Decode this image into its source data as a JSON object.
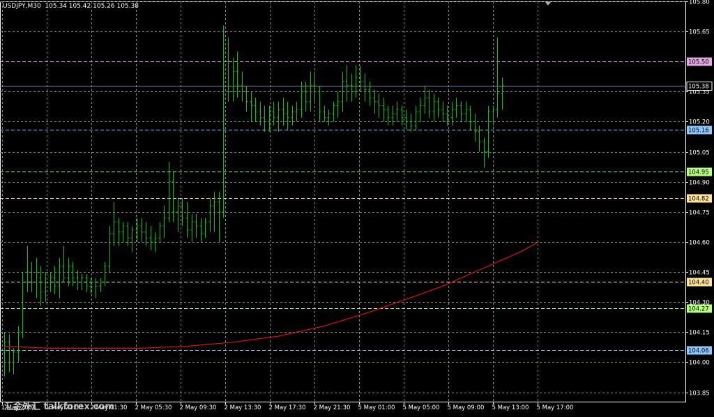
{
  "title": "USDJPY,M30  105.34 105.42 105.26 105.38",
  "watermark": "汇金外汇 talkforex.com",
  "colors": {
    "background": "#000000",
    "grid": "#8a8a8a",
    "bar": "#00c800",
    "ma_line": "#dd1111",
    "axis_text": "#ffffff",
    "frame": "#ffffff"
  },
  "chart_data": {
    "type": "ohlc",
    "symbol": "USDJPY",
    "timeframe": "M30",
    "header_ohlc": {
      "open": 105.34,
      "high": 105.42,
      "low": 105.26,
      "close": 105.38
    },
    "ylim": [
      103.8,
      105.8
    ],
    "y_ticks": [
      "105.80",
      "105.65",
      "105.35",
      "105.20",
      "105.05",
      "104.90",
      "104.75",
      "104.60",
      "104.45",
      "104.30",
      "104.15",
      "104.00",
      "103.85"
    ],
    "x_ticks": [
      "1 May 2008",
      "1 May 21:30",
      "2 May 01:30",
      "2 May 05:30",
      "2 May 09:30",
      "2 May 13:30",
      "2 May 17:30",
      "2 May 21:30",
      "5 May 01:00",
      "5 May 05:00",
      "5 May 09:00",
      "5 May 13:00",
      "5 May 17:00"
    ],
    "grid": true,
    "price_levels": [
      {
        "label": "105.50",
        "value": 105.5,
        "color": "#e0a8e0"
      },
      {
        "label": "105.38",
        "value": 105.38,
        "color": "#ffffff",
        "current": true
      },
      {
        "label": "105.16",
        "value": 105.16,
        "color": "#8cc8ff"
      },
      {
        "label": "104.95",
        "value": 104.95,
        "color": "#b8ff80"
      },
      {
        "label": "104.82",
        "value": 104.82,
        "color": "#ffe39a"
      },
      {
        "label": "104.40",
        "value": 104.4,
        "color": "#ffe39a"
      },
      {
        "label": "104.27",
        "value": 104.27,
        "color": "#b8ff80"
      },
      {
        "label": "104.06",
        "value": 104.06,
        "color": "#8cc8ff"
      }
    ],
    "bars": [
      [
        104.05,
        104.15,
        103.93,
        104.1
      ],
      [
        104.1,
        104.14,
        103.95,
        104.0
      ],
      [
        104.0,
        104.07,
        103.94,
        104.05
      ],
      [
        104.05,
        104.18,
        104.0,
        104.15
      ],
      [
        104.15,
        104.45,
        104.12,
        104.4
      ],
      [
        104.4,
        104.58,
        104.35,
        104.45
      ],
      [
        104.45,
        104.5,
        104.35,
        104.4
      ],
      [
        104.4,
        104.52,
        104.32,
        104.45
      ],
      [
        104.42,
        104.48,
        104.28,
        104.35
      ],
      [
        104.35,
        104.45,
        104.3,
        104.4
      ],
      [
        104.4,
        104.45,
        104.35,
        104.42
      ],
      [
        104.42,
        104.48,
        104.34,
        104.38
      ],
      [
        104.38,
        104.52,
        104.32,
        104.48
      ],
      [
        104.48,
        104.58,
        104.4,
        104.42
      ],
      [
        104.42,
        104.52,
        104.38,
        104.48
      ],
      [
        104.48,
        104.5,
        104.38,
        104.42
      ],
      [
        104.42,
        104.46,
        104.36,
        104.4
      ],
      [
        104.4,
        104.44,
        104.36,
        104.42
      ],
      [
        104.42,
        104.44,
        104.35,
        104.38
      ],
      [
        104.38,
        104.42,
        104.34,
        104.4
      ],
      [
        104.4,
        104.42,
        104.32,
        104.38
      ],
      [
        104.38,
        104.42,
        104.35,
        104.4
      ],
      [
        104.4,
        104.5,
        104.38,
        104.48
      ],
      [
        104.48,
        104.68,
        104.45,
        104.64
      ],
      [
        104.64,
        104.8,
        104.58,
        104.7
      ],
      [
        104.7,
        104.72,
        104.58,
        104.65
      ],
      [
        104.65,
        104.7,
        104.6,
        104.68
      ],
      [
        104.68,
        104.7,
        104.58,
        104.62
      ],
      [
        104.62,
        104.68,
        104.55,
        104.66
      ],
      [
        104.66,
        104.72,
        104.6,
        104.68
      ],
      [
        104.68,
        104.72,
        104.6,
        104.65
      ],
      [
        104.65,
        104.7,
        104.58,
        104.62
      ],
      [
        104.62,
        104.68,
        104.56,
        104.6
      ],
      [
        104.6,
        104.65,
        104.55,
        104.62
      ],
      [
        104.62,
        104.7,
        104.6,
        104.68
      ],
      [
        104.68,
        104.78,
        104.62,
        104.72
      ],
      [
        104.72,
        105.0,
        104.7,
        104.9
      ],
      [
        104.9,
        104.95,
        104.7,
        104.75
      ],
      [
        104.75,
        104.82,
        104.65,
        104.78
      ],
      [
        104.78,
        104.82,
        104.68,
        104.72
      ],
      [
        104.72,
        104.8,
        104.62,
        104.66
      ],
      [
        104.66,
        104.74,
        104.6,
        104.7
      ],
      [
        104.7,
        104.74,
        104.62,
        104.68
      ],
      [
        104.68,
        104.72,
        104.6,
        104.64
      ],
      [
        104.64,
        104.72,
        104.62,
        104.7
      ],
      [
        104.7,
        104.82,
        104.65,
        104.78
      ],
      [
        104.78,
        104.85,
        104.65,
        104.8
      ],
      [
        104.8,
        104.85,
        104.6,
        104.75
      ],
      [
        104.75,
        105.68,
        104.72,
        105.5
      ],
      [
        105.5,
        105.62,
        105.3,
        105.35
      ],
      [
        105.35,
        105.52,
        105.3,
        105.45
      ],
      [
        105.45,
        105.55,
        105.32,
        105.38
      ],
      [
        105.38,
        105.45,
        105.3,
        105.35
      ],
      [
        105.35,
        105.38,
        105.25,
        105.3
      ],
      [
        105.3,
        105.35,
        105.2,
        105.28
      ],
      [
        105.28,
        105.32,
        105.2,
        105.25
      ],
      [
        105.25,
        105.3,
        105.18,
        105.22
      ],
      [
        105.22,
        105.28,
        105.15,
        105.2
      ],
      [
        105.2,
        105.28,
        105.15,
        105.25
      ],
      [
        105.25,
        105.3,
        105.18,
        105.22
      ],
      [
        105.22,
        105.3,
        105.15,
        105.26
      ],
      [
        105.26,
        105.32,
        105.18,
        105.24
      ],
      [
        105.24,
        105.3,
        105.16,
        105.22
      ],
      [
        105.22,
        105.28,
        105.18,
        105.25
      ],
      [
        105.25,
        105.3,
        105.2,
        105.26
      ],
      [
        105.26,
        105.4,
        105.22,
        105.35
      ],
      [
        105.35,
        105.4,
        105.25,
        105.3
      ],
      [
        105.3,
        105.45,
        105.25,
        105.38
      ],
      [
        105.38,
        105.45,
        105.3,
        105.35
      ],
      [
        105.35,
        105.38,
        105.2,
        105.25
      ],
      [
        105.25,
        105.28,
        105.2,
        105.22
      ],
      [
        105.22,
        105.26,
        105.18,
        105.24
      ],
      [
        105.24,
        105.3,
        105.2,
        105.28
      ],
      [
        105.28,
        105.35,
        105.22,
        105.3
      ],
      [
        105.3,
        105.45,
        105.25,
        105.4
      ],
      [
        105.4,
        105.48,
        105.3,
        105.38
      ],
      [
        105.38,
        105.44,
        105.3,
        105.35
      ],
      [
        105.35,
        105.48,
        105.32,
        105.42
      ],
      [
        105.42,
        105.48,
        105.35,
        105.4
      ],
      [
        105.4,
        105.44,
        105.3,
        105.36
      ],
      [
        105.36,
        105.4,
        105.28,
        105.32
      ],
      [
        105.32,
        105.36,
        105.24,
        105.3
      ],
      [
        105.3,
        105.34,
        105.22,
        105.28
      ],
      [
        105.28,
        105.32,
        105.2,
        105.26
      ],
      [
        105.26,
        105.28,
        105.18,
        105.22
      ],
      [
        105.22,
        105.28,
        105.18,
        105.24
      ],
      [
        105.24,
        105.3,
        105.2,
        105.26
      ],
      [
        105.26,
        105.28,
        105.18,
        105.22
      ],
      [
        105.22,
        105.26,
        105.16,
        105.2
      ],
      [
        105.2,
        105.24,
        105.15,
        105.18
      ],
      [
        105.18,
        105.28,
        105.16,
        105.25
      ],
      [
        105.25,
        105.32,
        105.2,
        105.28
      ],
      [
        105.28,
        105.38,
        105.24,
        105.32
      ],
      [
        105.32,
        105.36,
        105.22,
        105.25
      ],
      [
        105.25,
        105.34,
        105.2,
        105.3
      ],
      [
        105.3,
        105.32,
        105.22,
        105.26
      ],
      [
        105.26,
        105.3,
        105.2,
        105.24
      ],
      [
        105.24,
        105.28,
        105.18,
        105.22
      ],
      [
        105.22,
        105.3,
        105.18,
        105.26
      ],
      [
        105.26,
        105.32,
        105.22,
        105.28
      ],
      [
        105.28,
        105.3,
        105.2,
        105.24
      ],
      [
        105.24,
        105.3,
        105.2,
        105.26
      ],
      [
        105.26,
        105.28,
        105.16,
        105.2
      ],
      [
        105.2,
        105.24,
        105.1,
        105.15
      ],
      [
        105.15,
        105.18,
        105.05,
        105.1
      ],
      [
        105.1,
        105.12,
        104.97,
        105.05
      ],
      [
        105.05,
        105.28,
        105.02,
        105.25
      ],
      [
        105.25,
        105.28,
        105.18,
        105.26
      ],
      [
        105.26,
        105.62,
        105.22,
        105.34
      ],
      [
        105.34,
        105.42,
        105.26,
        105.38
      ]
    ],
    "ma_points": [
      [
        0,
        104.08
      ],
      [
        10,
        104.07
      ],
      [
        30,
        104.07
      ],
      [
        40,
        104.08
      ],
      [
        50,
        104.1
      ],
      [
        60,
        104.13
      ],
      [
        70,
        104.18
      ],
      [
        80,
        104.25
      ],
      [
        90,
        104.33
      ],
      [
        96,
        104.38
      ],
      [
        102,
        104.44
      ],
      [
        108,
        104.5
      ],
      [
        113,
        104.55
      ],
      [
        117,
        104.6
      ]
    ]
  }
}
